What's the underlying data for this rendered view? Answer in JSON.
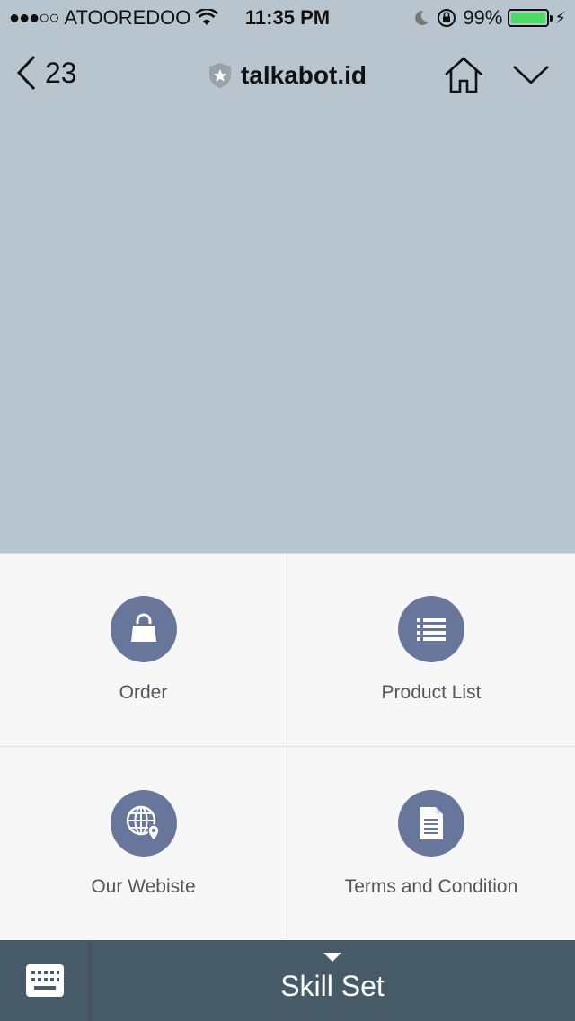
{
  "status_bar": {
    "signal": "●●●○○",
    "carrier": "ATOOREDOO",
    "time": "11:35 PM",
    "battery_percent": "99%",
    "battery_level": 0.99,
    "battery_color": "#4cd964"
  },
  "nav": {
    "back_count": "23",
    "title": "talkabot.id",
    "icons": [
      "chevron-left-icon",
      "shield-star-icon",
      "home-icon",
      "chevron-down-icon"
    ]
  },
  "menu": {
    "accent": "#68769b",
    "items": [
      {
        "label": "Order",
        "icon": "shopping-bag-icon"
      },
      {
        "label": "Product List",
        "icon": "list-icon"
      },
      {
        "label": "Our Webiste",
        "icon": "globe-location-icon"
      },
      {
        "label": "Terms and Condition",
        "icon": "document-icon"
      }
    ]
  },
  "bottom_bar": {
    "label": "Skill Set",
    "background": "#475a67",
    "icons": [
      "keyboard-icon",
      "caret-down-icon"
    ]
  }
}
